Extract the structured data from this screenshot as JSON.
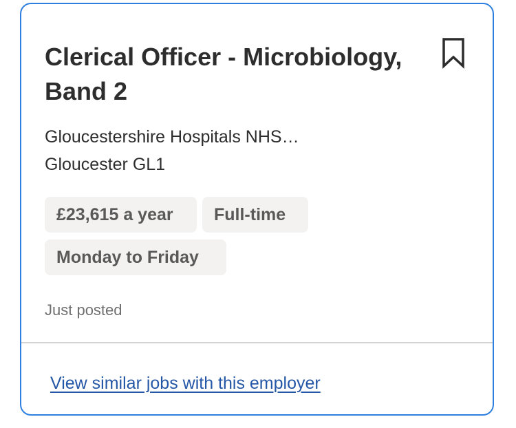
{
  "job": {
    "title": "Clerical Officer - Microbiology, Band 2",
    "company": "Gloucestershire Hospitals NHS…",
    "location": "Gloucester GL1",
    "tags": {
      "salary": "£23,615 a year",
      "job_type": "Full-time",
      "schedule": "Monday to Friday"
    },
    "posted": "Just posted"
  },
  "actions": {
    "bookmark_icon": "bookmark-icon",
    "similar_jobs_link": "View similar jobs with this employer"
  },
  "colors": {
    "card_border": "#2f7fe0",
    "link": "#2557a7",
    "tag_background": "#f3f2f1",
    "title_text": "#2d2d2d"
  }
}
